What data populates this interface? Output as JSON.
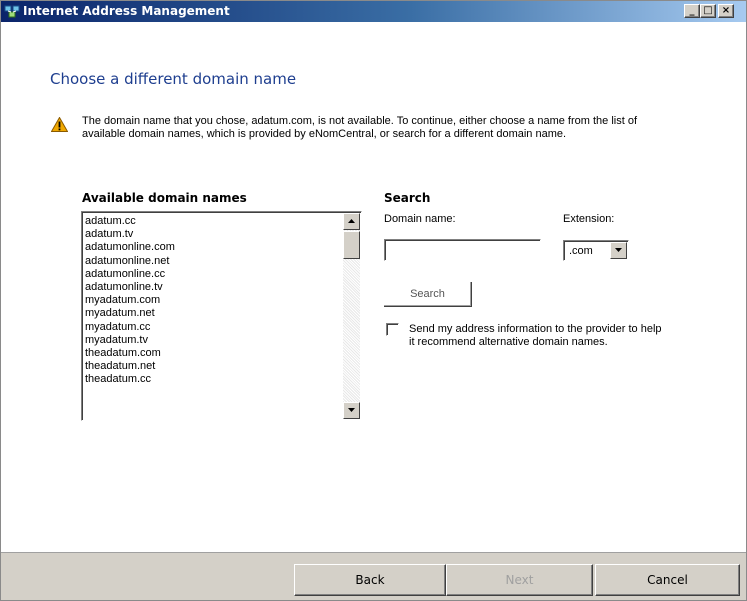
{
  "window": {
    "title": "Internet Address Management",
    "controls": {
      "minimize": "_",
      "maximize": "□",
      "close": "×"
    }
  },
  "heading": "Choose a different domain name",
  "warning": {
    "icon": "warning-icon",
    "text": "The domain name that you chose, adatum.com, is not available. To continue, either choose a name from the list of available domain names, which is provided by eNomCentral, or search for a different domain name."
  },
  "available": {
    "label": "Available domain names",
    "items": [
      "adatum.cc",
      "adatum.tv",
      "adatumonline.com",
      "adatumonline.net",
      "adatumonline.cc",
      "adatumonline.tv",
      "myadatum.com",
      "myadatum.net",
      "myadatum.cc",
      "myadatum.tv",
      "theadatum.com",
      "theadatum.net",
      "theadatum.cc"
    ]
  },
  "search": {
    "label": "Search",
    "domain_label": "Domain name:",
    "domain_value": "",
    "extension_label": "Extension:",
    "extension_value": ".com",
    "button_label": "Search",
    "checkbox_checked": false,
    "checkbox_label": "Send my address information to the provider to help it recommend alternative domain names."
  },
  "footer": {
    "back": "Back",
    "next": "Next",
    "cancel": "Cancel"
  },
  "colors": {
    "heading": "#1e3e8f",
    "titlebar_start": "#0a246a",
    "footer_bg": "#d4d0c8",
    "disabled_text": "#a0a0a0"
  }
}
